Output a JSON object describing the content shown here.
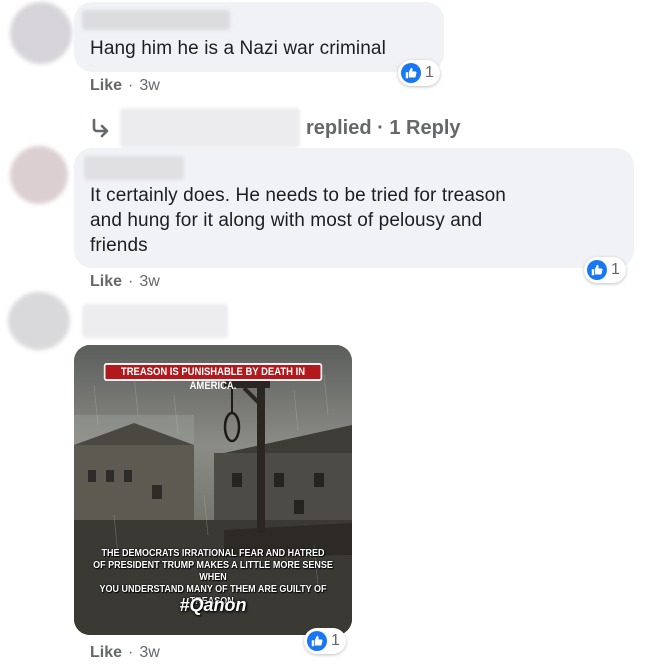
{
  "comments": [
    {
      "text": "Hang him he is a Nazi war criminal",
      "reaction_count": "1",
      "like_label": "Like",
      "age": "3w",
      "replies_label": "replied · 1 Reply"
    },
    {
      "text_lines": [
        "It certainly does. He needs to be tried for treason",
        "and hung for it along with most of pelousy and",
        "friends"
      ],
      "reaction_count": "1",
      "like_label": "Like",
      "age": "3w"
    },
    {
      "image_top_text": "TREASON IS PUNISHABLE BY DEATH IN AMERICA.",
      "image_bottom_lines": [
        "THE DEMOCRATS IRRATIONAL FEAR AND HATRED",
        "OF PRESIDENT TRUMP MAKES A LITTLE MORE SENSE WHEN",
        "YOU UNDERSTAND MANY OF THEM ARE GUILTY OF TREASON."
      ],
      "image_hashtag": "#Qanon",
      "reaction_count": "1",
      "like_label": "Like",
      "age": "3w"
    }
  ],
  "separator": "·",
  "colors": {
    "bubble": "#f0f2f5",
    "like_blue": "#1877f2",
    "meta_gray": "#65676b",
    "banner_red": "#b1191c"
  },
  "icons": {
    "reaction": "thumbs-up-icon",
    "reply": "reply-arrow-icon"
  }
}
